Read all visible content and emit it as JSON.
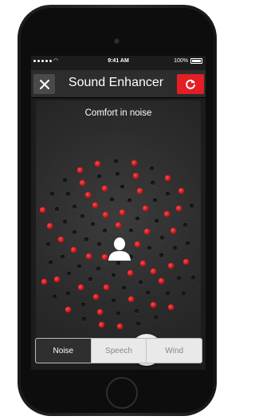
{
  "status_bar": {
    "time": "9:41 AM",
    "battery": "100%"
  },
  "nav": {
    "title": "Sound Enhancer",
    "close_icon": "close-icon",
    "reset_icon": "reset-icon",
    "accent_color": "#e31e24"
  },
  "main": {
    "mode_label": "Comfort in noise"
  },
  "slider": {
    "value_fraction": 0.68
  },
  "segments": [
    {
      "label": "Noise",
      "active": true
    },
    {
      "label": "Speech",
      "active": false
    },
    {
      "label": "Wind",
      "active": false
    }
  ]
}
